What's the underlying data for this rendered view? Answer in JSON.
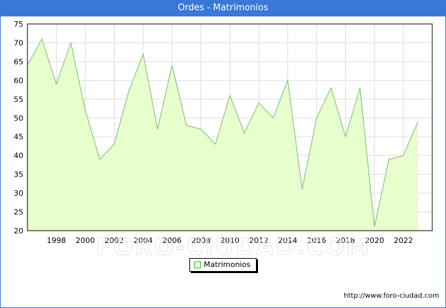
{
  "window": {
    "title": "Ordes - Matrimonios"
  },
  "chart_data": {
    "type": "area",
    "title": "Ordes - Matrimonios",
    "x": [
      1996,
      1997,
      1998,
      1999,
      2000,
      2001,
      2002,
      2003,
      2004,
      2005,
      2006,
      2007,
      2008,
      2009,
      2010,
      2011,
      2012,
      2013,
      2014,
      2015,
      2016,
      2017,
      2018,
      2019,
      2020,
      2021,
      2022,
      2023
    ],
    "series": [
      {
        "name": "Matrimonios",
        "values": [
          64,
          71,
          59,
          70,
          52,
          39,
          43,
          57,
          67,
          47,
          64,
          48,
          47,
          43,
          56,
          46,
          54,
          50,
          60,
          31,
          50,
          58,
          45,
          58,
          21,
          39,
          40,
          49
        ]
      }
    ],
    "x_tick_labels": [
      "1998",
      "2000",
      "2002",
      "2004",
      "2006",
      "2008",
      "2010",
      "2012",
      "2014",
      "2016",
      "2018",
      "2020",
      "2022"
    ],
    "y_tick_labels": [
      "20",
      "25",
      "30",
      "35",
      "40",
      "45",
      "50",
      "55",
      "60",
      "65",
      "70",
      "75"
    ],
    "ylim": [
      20,
      75
    ],
    "grid": true,
    "legend": "bottom-center",
    "colors": {
      "fill": "#e6ffcc",
      "line": "#7ab87a",
      "header": "#3a78d8"
    }
  },
  "legend": {
    "label": "Matrimonios"
  },
  "footer": {
    "source": "http://www.foro-ciudad.com"
  },
  "watermark": "FORO-CIUDAD.COM"
}
